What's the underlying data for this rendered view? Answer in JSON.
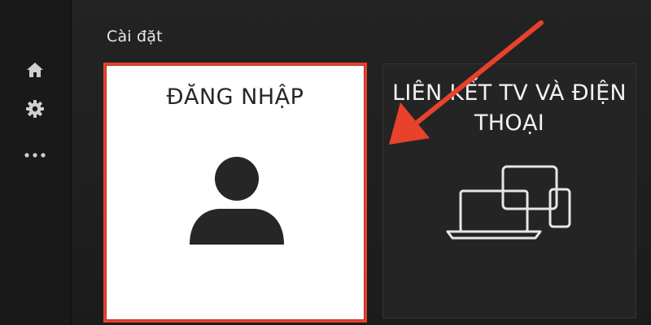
{
  "page": {
    "title": "Cài đặt"
  },
  "sidebar": {
    "items": [
      {
        "icon": "home-icon"
      },
      {
        "icon": "gear-icon"
      },
      {
        "icon": "more-icon"
      }
    ]
  },
  "cards": {
    "login": {
      "title": "ĐĂNG NHẬP",
      "icon": "user-icon",
      "selected": true
    },
    "link_tv": {
      "title_line1": "LIÊN KẾT TV VÀ ĐIỆN",
      "title_line2": "THOẠI",
      "icon": "devices-icon"
    }
  },
  "colors": {
    "background": "#202020",
    "sidebar": "#191919",
    "accent": "#e5412f",
    "arrow": "#e8412c",
    "card_selected_bg": "#ffffff",
    "card_bg": "#242424"
  }
}
